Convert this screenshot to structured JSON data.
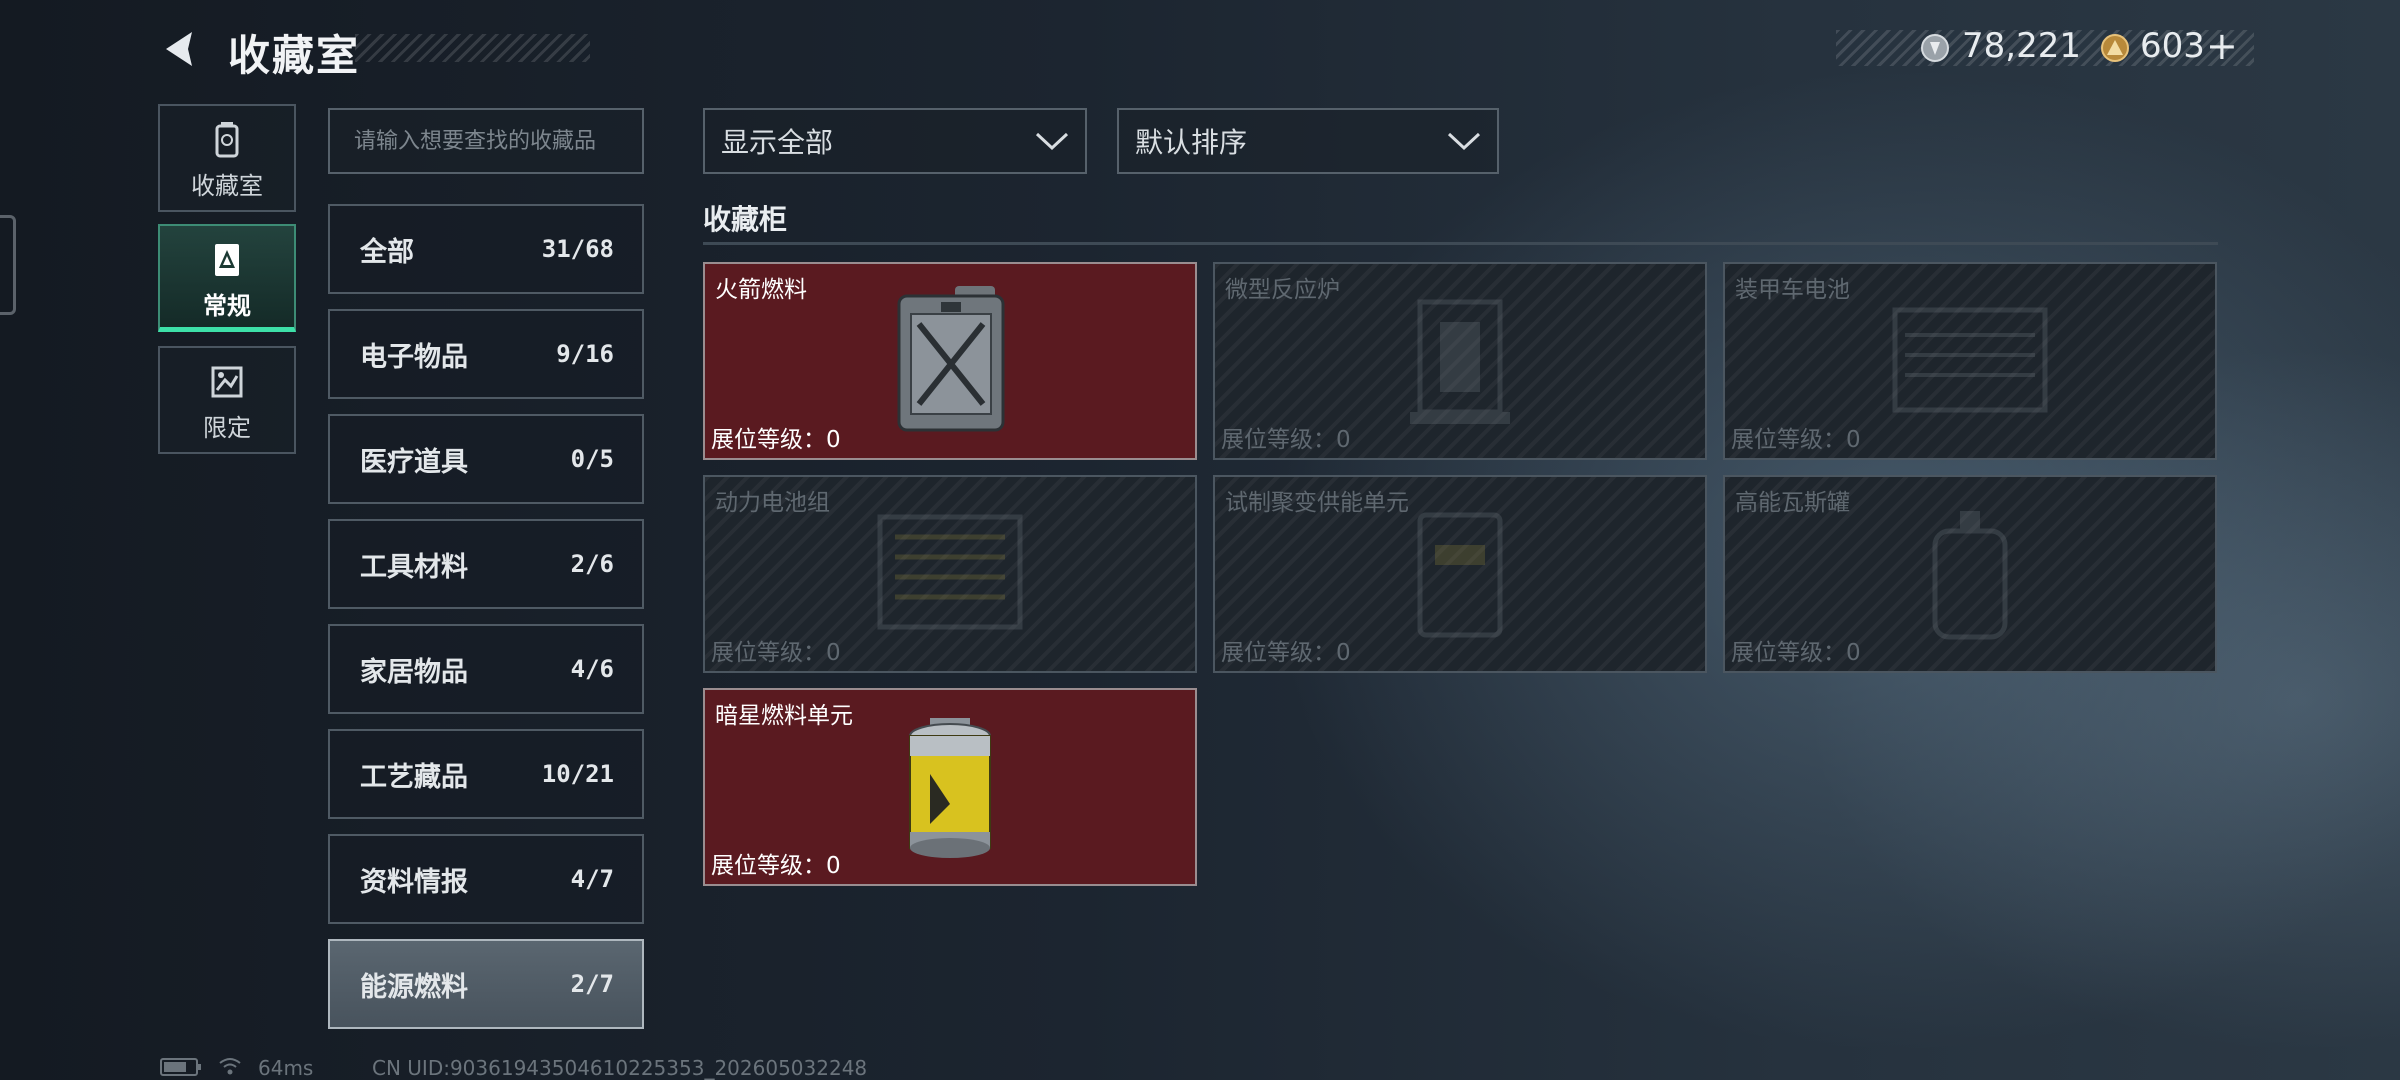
{
  "header": {
    "title": "收藏室",
    "currency1": "78,221",
    "currency2": "603",
    "add_symbol": "+"
  },
  "left_tabs": [
    {
      "label": "收藏室",
      "icon": "trash-can-icon"
    },
    {
      "label": "常规",
      "icon": "collection-card-icon"
    },
    {
      "label": "限定",
      "icon": "limited-map-icon"
    }
  ],
  "search": {
    "placeholder": "请输入想要查找的收藏品",
    "value": ""
  },
  "categories": [
    {
      "name": "全部",
      "count": "31/68"
    },
    {
      "name": "电子物品",
      "count": "9/16"
    },
    {
      "name": "医疗道具",
      "count": "0/5"
    },
    {
      "name": "工具材料",
      "count": "2/6"
    },
    {
      "name": "家居物品",
      "count": "4/6"
    },
    {
      "name": "工艺藏品",
      "count": "10/21"
    },
    {
      "name": "资料情报",
      "count": "4/7"
    },
    {
      "name": "能源燃料",
      "count": "2/7"
    }
  ],
  "filters": {
    "show": "显示全部",
    "sort": "默认排序"
  },
  "section_title": "收藏柜",
  "items": [
    {
      "name": "火箭燃料",
      "level": "展位等级：0",
      "owned": true
    },
    {
      "name": "微型反应炉",
      "level": "展位等级：0",
      "owned": false
    },
    {
      "name": "装甲车电池",
      "level": "展位等级：0",
      "owned": false
    },
    {
      "name": "动力电池组",
      "level": "展位等级：0",
      "owned": false
    },
    {
      "name": "试制聚变供能单元",
      "level": "展位等级：0",
      "owned": false
    },
    {
      "name": "高能瓦斯罐",
      "level": "展位等级：0",
      "owned": false
    },
    {
      "name": "暗星燃料单元",
      "level": "展位等级：0",
      "owned": true
    }
  ],
  "footer": {
    "ping": "64ms",
    "uid": "CN UID:9036194350461022535​3_202605032248"
  },
  "colors": {
    "accent": "#3de0a8",
    "owned_card": "#5a1a20",
    "background": "#1c2530"
  }
}
